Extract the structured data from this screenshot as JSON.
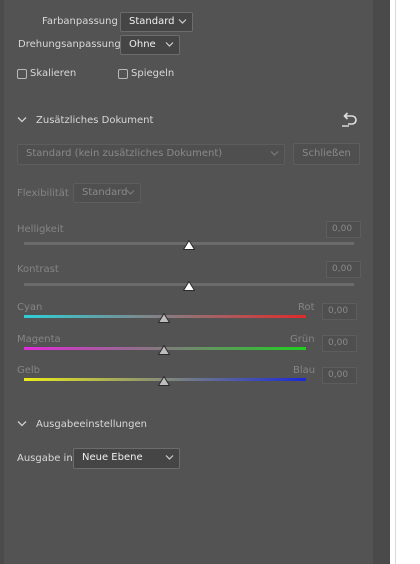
{
  "panel": {
    "farbanpassung": {
      "label": "Farbanpassung",
      "value": "Standard"
    },
    "drehungsanpassung": {
      "label": "Drehungsanpassung",
      "value": "Ohne"
    },
    "skalieren_label": "Skalieren",
    "spiegeln_label": "Spiegeln",
    "skalieren_checked": false,
    "spiegeln_checked": false
  },
  "zusatz": {
    "title": "Zusätzliches Dokument",
    "document_select": "Standard (kein zusätzliches Dokument)",
    "close_button": "Schließen",
    "flexibility_label": "Flexibilität",
    "flexibility_value": "Standard",
    "reset_icon": "reset-arrow-icon"
  },
  "sliders": {
    "helligkeit": {
      "label": "Helligkeit",
      "value": "0,00",
      "level": 0.5,
      "enabled": false
    },
    "kontrast": {
      "label": "Kontrast",
      "value": "0,00",
      "level": 0.5,
      "enabled": false
    },
    "cyan_rot": {
      "left": "Cyan",
      "right": "Rot",
      "value": "0,00",
      "level": 0.5,
      "colors": [
        "#2fd0d8",
        "#e02a2a"
      ]
    },
    "magenta_gruen": {
      "left": "Magenta",
      "right": "Grün",
      "value": "0,00",
      "level": 0.5,
      "colors": [
        "#e22ad8",
        "#1fcf1f"
      ]
    },
    "gelb_blau": {
      "left": "Gelb",
      "right": "Blau",
      "value": "0,00",
      "level": 0.5,
      "colors": [
        "#ecec1a",
        "#1a28d8"
      ]
    }
  },
  "ausgabe": {
    "title": "Ausgabeeinstellungen",
    "label": "Ausgabe in",
    "value": "Neue Ebene"
  },
  "colors": {
    "panel_bg": "#535353",
    "text": "#d8d8d8",
    "disabled_text": "#858585"
  }
}
